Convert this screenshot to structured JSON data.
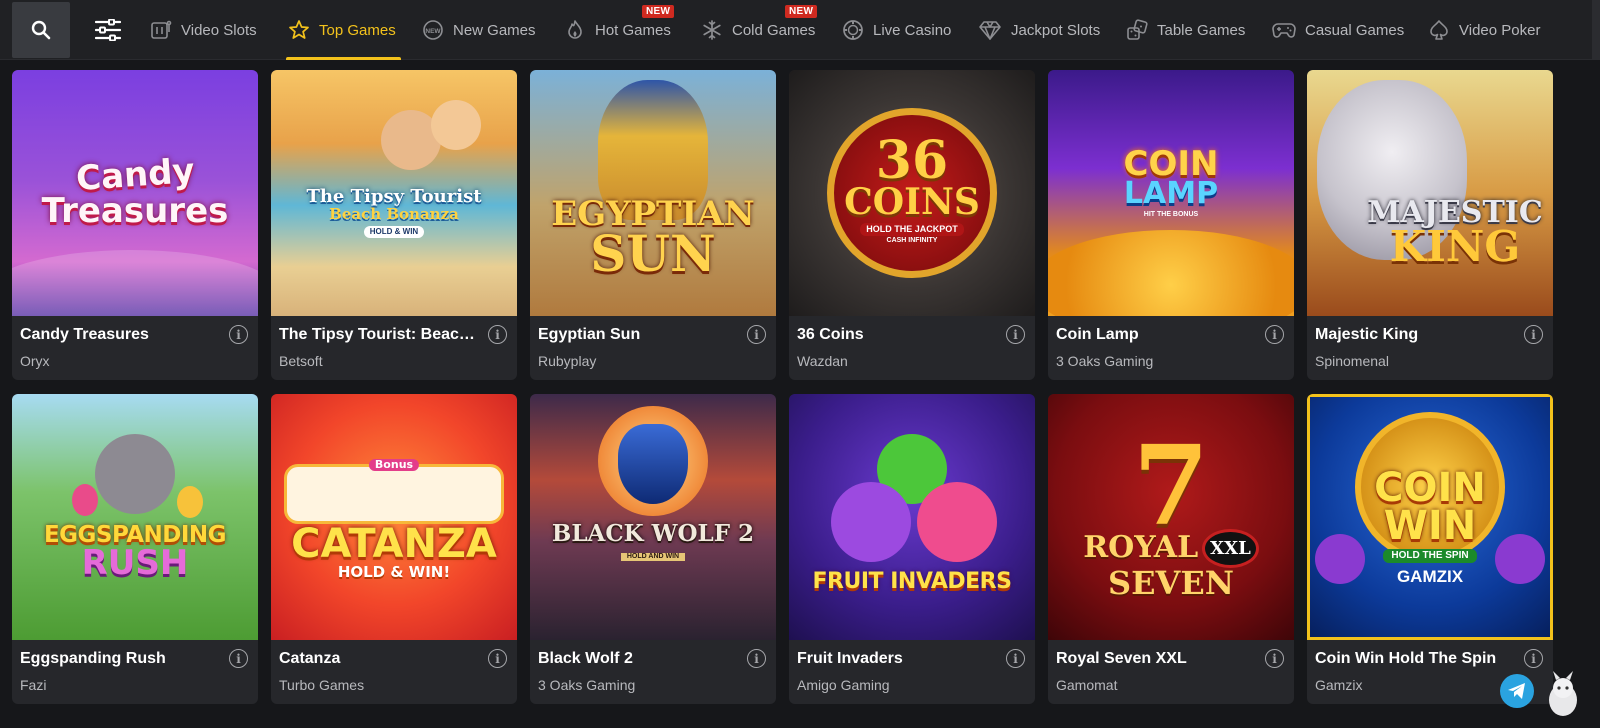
{
  "nav": {
    "tabs": [
      {
        "label": "Video Slots",
        "icon": "slot-machine-icon",
        "active": false
      },
      {
        "label": "Top Games",
        "icon": "star-icon",
        "active": true
      },
      {
        "label": "New Games",
        "icon": "new-circle-icon",
        "active": false
      },
      {
        "label": "Hot Games",
        "icon": "flame-icon",
        "active": false,
        "badge": "NEW"
      },
      {
        "label": "Cold Games",
        "icon": "snowflake-icon",
        "active": false,
        "badge": "NEW"
      },
      {
        "label": "Live Casino",
        "icon": "chip-icon",
        "active": false
      },
      {
        "label": "Jackpot Slots",
        "icon": "diamond-icon",
        "active": false
      },
      {
        "label": "Table Games",
        "icon": "dice-icon",
        "active": false
      },
      {
        "label": "Casual Games",
        "icon": "gamepad-icon",
        "active": false
      },
      {
        "label": "Video Poker",
        "icon": "spade-icon",
        "active": false
      }
    ]
  },
  "games": [
    {
      "title": "Candy Treasures",
      "provider": "Oryx",
      "art": [
        "Candy",
        "Treasures"
      ]
    },
    {
      "title": "The Tipsy Tourist: Beach Bonanza",
      "provider": "Betsoft",
      "art": [
        "The Tipsy Tourist",
        "Beach Bonanza",
        "HOLD & WIN"
      ]
    },
    {
      "title": "Egyptian Sun",
      "provider": "Rubyplay",
      "art": [
        "EGYPTIAN",
        "SUN"
      ]
    },
    {
      "title": "36 Coins",
      "provider": "Wazdan",
      "art": [
        "36",
        "COINS",
        "HOLD THE JACKPOT",
        "CASH INFINITY"
      ]
    },
    {
      "title": "Coin Lamp",
      "provider": "3 Oaks Gaming",
      "art": [
        "COIN",
        "LAMP",
        "HIT THE BONUS"
      ]
    },
    {
      "title": "Majestic King",
      "provider": "Spinomenal",
      "art": [
        "MAJESTIC",
        "KING"
      ]
    },
    {
      "title": "Eggspanding Rush",
      "provider": "Fazi",
      "art": [
        "EGGSPANDING",
        "RUSH"
      ]
    },
    {
      "title": "Catanza",
      "provider": "Turbo Games",
      "art": [
        "CATANZA",
        "HOLD & WIN!",
        "Bonus"
      ]
    },
    {
      "title": "Black Wolf 2",
      "provider": "3 Oaks Gaming",
      "art": [
        "BLACK WOLF 2",
        "HOLD AND WIN"
      ]
    },
    {
      "title": "Fruit Invaders",
      "provider": "Amigo Gaming",
      "art": [
        "FRUIT INVADERS"
      ]
    },
    {
      "title": "Royal Seven XXL",
      "provider": "Gamomat",
      "art": [
        "7",
        "ROYAL",
        "XXL",
        "SEVEN"
      ]
    },
    {
      "title": "Coin Win Hold The Spin",
      "provider": "Gamzix",
      "art": [
        "COIN",
        "WIN",
        "HOLD THE SPIN",
        "GAMZIX"
      ]
    }
  ],
  "colors": {
    "accent": "#f3c21c",
    "badge": "#cf2a20",
    "card": "#26272b",
    "background": "#16171a"
  },
  "widgets": {
    "telegram": "telegram-icon",
    "chat_bot": "chat-bot-icon"
  }
}
